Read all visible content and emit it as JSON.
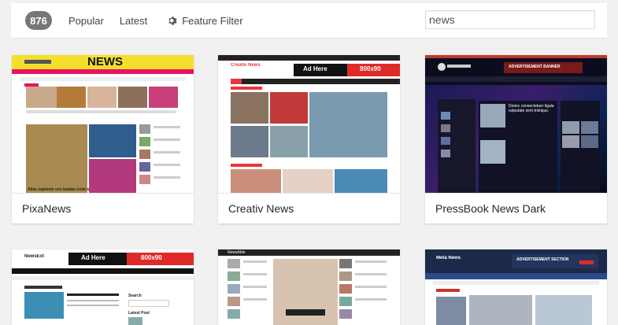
{
  "filter_bar": {
    "count": "876",
    "popular": "Popular",
    "latest": "Latest",
    "feature_filter": "Feature Filter",
    "search_value": "news"
  },
  "colors": {
    "count_badge": "#777777",
    "pixanews_yellow": "#f4e02b",
    "pixanews_pink": "#e8135e",
    "creativ_red": "#e8383d",
    "pressbook_dark": "#0b0d1f",
    "adhere_red": "#e02a2a"
  },
  "themes": [
    {
      "name": "PixaNews",
      "preview": {
        "logo": "NEWS",
        "headline": "Alias sapiente eos beatae iusto quia"
      }
    },
    {
      "name": "Creativ News",
      "preview": {
        "logo": "Creativ News",
        "ad_text": "Ad Here",
        "ad_size": "800x90"
      }
    },
    {
      "name": "PressBook News Dark",
      "preview": {
        "banner": "ADVERTISEMENT BANNER",
        "headline": "Donec consectetuer ligula vulputate sem tristique."
      }
    },
    {
      "name": "",
      "preview": {
        "logo": "NewsExt",
        "ad_text": "Ad Here",
        "ad_size": "800x90",
        "sidebar_title": "Search",
        "sidebar_title2": "Latest Post"
      }
    },
    {
      "name": "",
      "preview": {
        "logo": "NewsAble"
      }
    },
    {
      "name": "",
      "preview": {
        "logo": "Meta News",
        "banner": "ADVERTISEMENT SECTION"
      }
    }
  ]
}
